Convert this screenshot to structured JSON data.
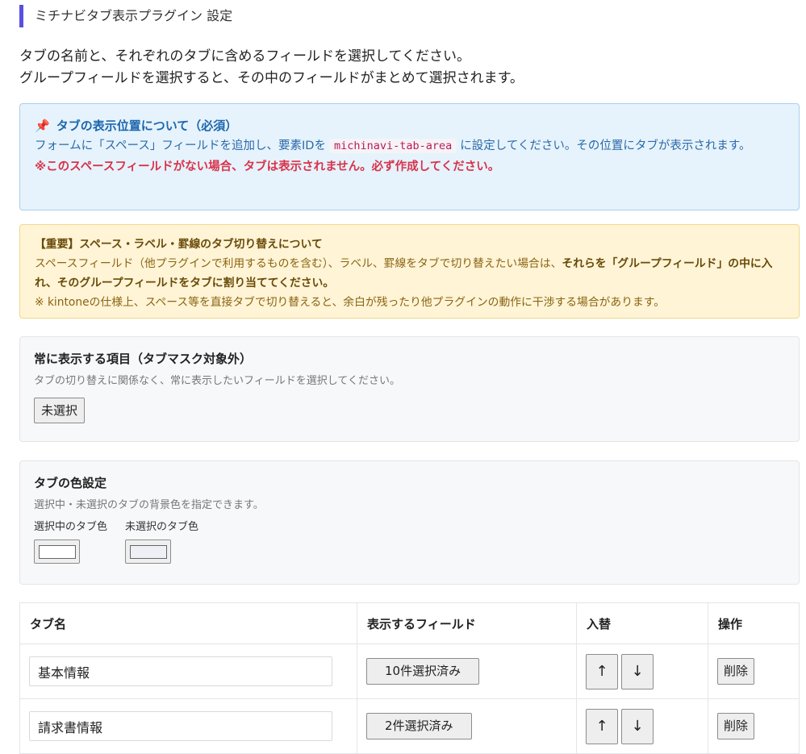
{
  "page": {
    "title": "ミチナビタブ表示プラグイン 設定",
    "intro": [
      "タブの名前と、それぞれのタブに含めるフィールドを選択してください。",
      "グループフィールドを選択すると、その中のフィールドがまとめて選択されます。"
    ]
  },
  "info_box": {
    "icon": "pushpin-icon",
    "heading": "タブの表示位置について（必須）",
    "body_before": "フォームに「スペース」フィールドを追加し、要素IDを",
    "element_id": "michinavi-tab-area",
    "body_after": "に設定してください。その位置にタブが表示されます。",
    "warning": "※このスペースフィールドがない場合、タブは表示されません。必ず作成してください。"
  },
  "notice_box": {
    "heading": "【重要】スペース・ラベル・罫線のタブ切り替えについて",
    "text_before": "スペースフィールド（他プラグインで利用するものを含む）、ラベル、罫線をタブで切り替えたい場合は、",
    "text_bold": "それらを「グループフィールド」の中に入れ、そのグループフィールドをタブに割り当ててください。",
    "note": "※ kintoneの仕様上、スペース等を直接タブで切り替えると、余白が残ったり他プラグインの動作に干渉する場合があります。"
  },
  "always_panel": {
    "title": "常に表示する項目（タブマスク対象外）",
    "description": "タブの切り替えに関係なく、常に表示したいフィールドを選択してください。",
    "button_label": "未選択"
  },
  "color_panel": {
    "title": "タブの色設定",
    "description": "選択中・未選択のタブの背景色を指定できます。",
    "selected_label": "選択中のタブ色",
    "selected_color": "#ffffff",
    "unselected_label": "未選択のタブ色",
    "unselected_color": "#eef0f5"
  },
  "tab_table": {
    "headers": {
      "name": "タブ名",
      "fields": "表示するフィールド",
      "order": "入替",
      "actions": "操作"
    },
    "rows": [
      {
        "name": "基本情報",
        "fields": "10件選択済み",
        "up": "↑",
        "down": "↓",
        "delete": "削除"
      },
      {
        "name": "請求書情報",
        "fields": "2件選択済み",
        "up": "↑",
        "down": "↓",
        "delete": "削除"
      }
    ]
  },
  "colors": {
    "accent": "#5b4fe0",
    "info_bg": "#e6f3fc",
    "info_text": "#2b6aa8",
    "warning_red": "#d8334a",
    "notice_bg": "#fff4d6",
    "notice_text": "#8a6412",
    "code_text": "#c2185b"
  }
}
